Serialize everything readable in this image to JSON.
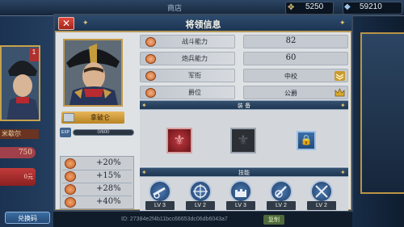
{
  "background": {
    "shop_title": "商店",
    "gold": "5250",
    "gems": "59210",
    "card_badge": "1",
    "side_name": "米歇尔",
    "side_number": "750",
    "side_red_button": "0元",
    "exchange_button": "兑换码",
    "player_id": "ID: 27384e2f4b11bcc66653dc06db6043a7",
    "copy_button": "复制"
  },
  "dialog": {
    "title": "将领信息",
    "close_label": "✕"
  },
  "general": {
    "name": "拿破仑",
    "exp_label": "EXP",
    "exp_text": "0/600",
    "exp_fraction": 0.0
  },
  "bonuses": [
    "+20%",
    "+15%",
    "+28%",
    "+40%"
  ],
  "stats": [
    {
      "label": "战斗能力",
      "value": "82",
      "icon": "sword-icon"
    },
    {
      "label": "炮兵能力",
      "value": "60",
      "icon": "cannon-icon"
    },
    {
      "label": "军衔",
      "value": "中校",
      "icon": "rank-icon"
    },
    {
      "label": "爵位",
      "value": "公爵",
      "icon": "crown-icon"
    }
  ],
  "equipment": {
    "title": "装  备",
    "slots": [
      {
        "state": "equipped",
        "icon": "fleur-de-lis-icon"
      },
      {
        "state": "empty",
        "icon": "fleur-de-lis-icon"
      },
      {
        "state": "locked",
        "icon": "lock-icon"
      }
    ]
  },
  "skills": {
    "title": "技能",
    "items": [
      {
        "icon": "cannon-skill-icon",
        "level": "LV 3"
      },
      {
        "icon": "target-skill-icon",
        "level": "LV 2"
      },
      {
        "icon": "fortress-skill-icon",
        "level": "LV 3"
      },
      {
        "icon": "artillery-skill-icon",
        "level": "LV 2"
      },
      {
        "icon": "crossed-swords-skill-icon",
        "level": "LV 2"
      }
    ]
  },
  "colors": {
    "header_blue": "#1d3553",
    "gold_trim": "#b69a58",
    "close_red": "#c23b3b",
    "panel_gray": "#dfe2e5"
  }
}
